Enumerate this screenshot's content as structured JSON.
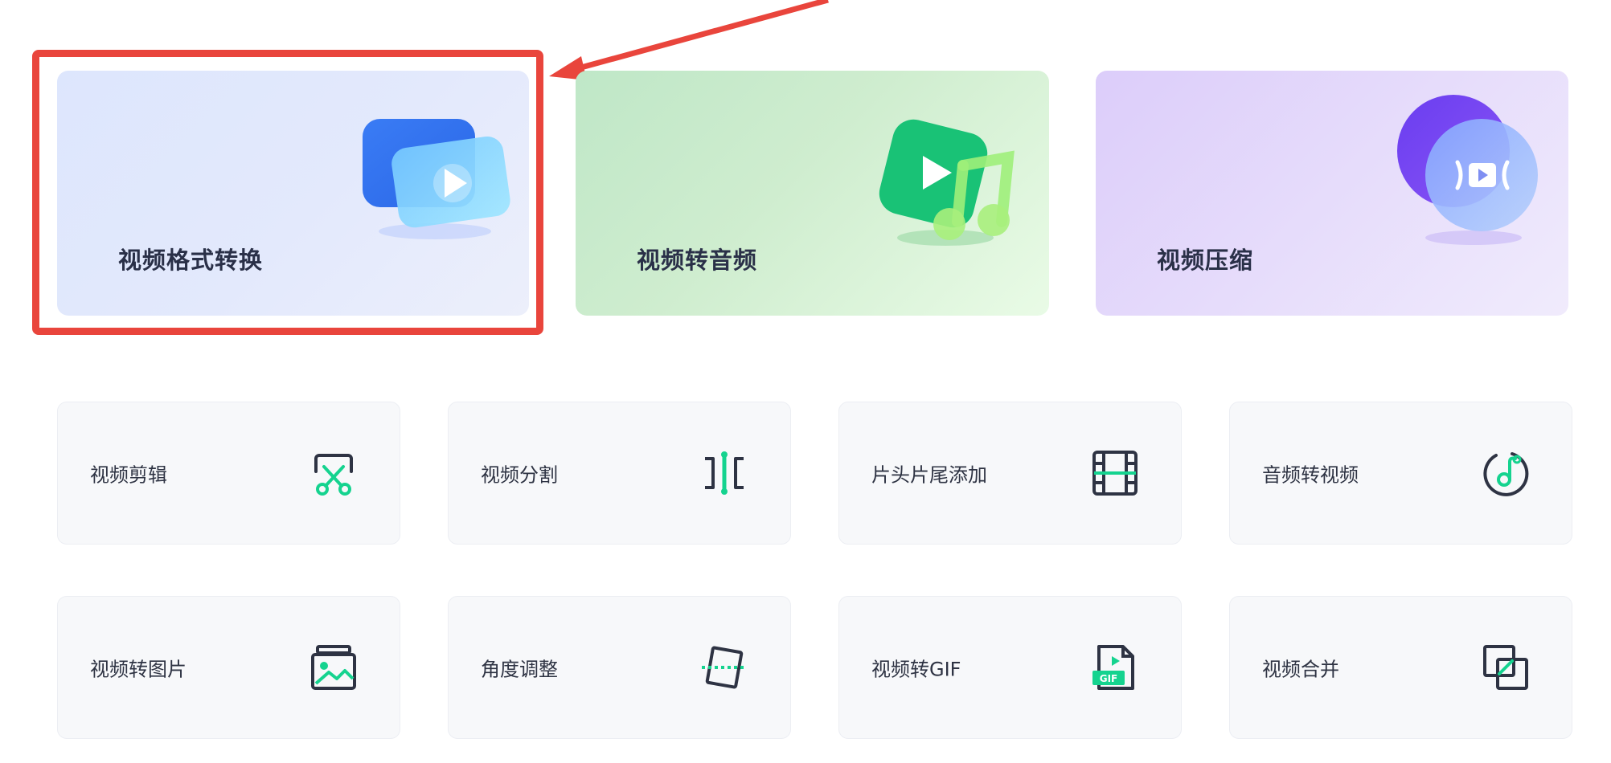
{
  "feature_cards": [
    {
      "label": "视频格式转换",
      "icon": "video-convert-icon"
    },
    {
      "label": "视频转音频",
      "icon": "video-to-audio-icon"
    },
    {
      "label": "视频压缩",
      "icon": "video-compress-icon"
    }
  ],
  "tools": [
    {
      "label": "视频剪辑",
      "icon": "scissors-icon"
    },
    {
      "label": "视频分割",
      "icon": "split-icon"
    },
    {
      "label": "片头片尾添加",
      "icon": "film-strip-icon"
    },
    {
      "label": "音频转视频",
      "icon": "music-note-icon"
    },
    {
      "label": "视频转图片",
      "icon": "image-icon"
    },
    {
      "label": "角度调整",
      "icon": "rotate-icon"
    },
    {
      "label": "视频转GIF",
      "icon": "gif-file-icon"
    },
    {
      "label": "视频合并",
      "icon": "merge-icon"
    }
  ],
  "colors": {
    "accent_green": "#15d38f",
    "icon_dark": "#2e3343",
    "annotation_red": "#e9453c"
  }
}
